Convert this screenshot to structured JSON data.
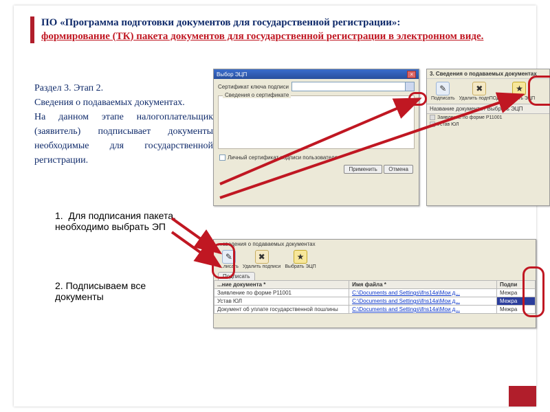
{
  "title": {
    "main": "ПО «Программа подготовки документов для государственной регистрации»:",
    "sub": "формирование (ТК) пакета документов для государственной регистрации в электронном виде."
  },
  "section": {
    "heading": "Раздел 3. Этап 2.",
    "line1": "Сведения о подаваемых документах.",
    "line2": "На данном этапе налогоплательщик (заявитель) подписывает документы необходимые для государственной регистрации."
  },
  "steps": {
    "n1_index": "1.",
    "n1": "Для подписания пакета, необходимо выбрать ЭП",
    "n2": "2. Подписываем все документы"
  },
  "panel1": {
    "win_title": "Выбор ЭЦП",
    "cert_label": "Сертификат ключа подписи",
    "group_title": "Сведения о сертификате",
    "chk_label": "Личный сертификат подписи пользователя",
    "btn_ok": "Применить",
    "btn_cancel": "Отмена",
    "close_x": "×"
  },
  "panel2": {
    "hdr": "3. Сведения о подаваемых документах",
    "tool_sign": "Подписать",
    "tool_del": "Удалить подпПОД",
    "tool_pick": "Выбрать ЭЦП",
    "col": "Название документа / Выбрать ЭЦП",
    "row1": "Заявление по форме Р11001",
    "row2": "Устав ЮЛ",
    "sign_glyph": "✎",
    "del_glyph": "✖",
    "pick_glyph": "★"
  },
  "panel3": {
    "hdr": "...сведения о подаваемых документах",
    "tool_sign": "...лисать",
    "tool_del": "Удалить подписи",
    "tool_pick": "Выбрать ЭЦП",
    "tab": "Подписать",
    "col_name": "...ние документа *",
    "col_file": "Имя файла *",
    "col_sign": "Подпи",
    "rows": [
      {
        "name": "Заявление по форме Р11001",
        "file": "C:\\Documents and Settings\\ifns14a\\Мои д...",
        "sign": "Межра"
      },
      {
        "name": "Устав ЮЛ",
        "file": "C:\\Documents and Settings\\ifns14a\\Мои д...",
        "sign": "Межра"
      },
      {
        "name": "Документ об уплате государственной пошлины",
        "file": "C:\\Documents and Settings\\ifns14a\\Мои д...",
        "sign": "Межра"
      }
    ],
    "sign_glyph": "✎",
    "del_glyph": "✖",
    "pick_glyph": "★"
  }
}
